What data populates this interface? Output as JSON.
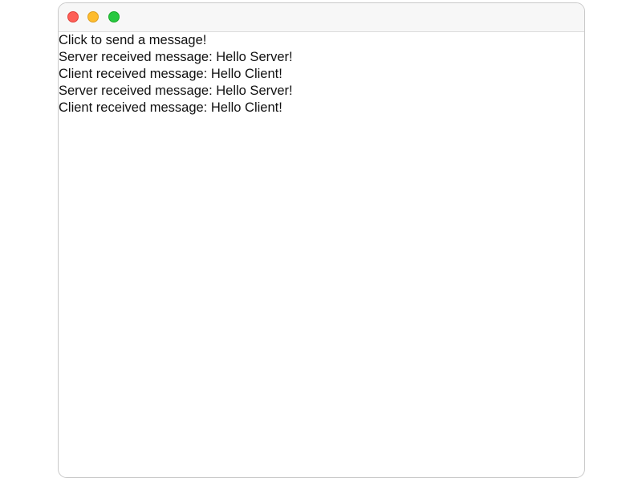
{
  "window": {
    "title": "",
    "buttons": {
      "close": "close",
      "minimize": "minimize",
      "zoom": "zoom"
    }
  },
  "content": {
    "prompt": "Click to send a message!",
    "messages": [
      "Server received message: Hello Server!",
      "Client received message: Hello Client!",
      "Server received message: Hello Server!",
      "Client received message: Hello Client!"
    ]
  },
  "colors": {
    "close": "#fe5f57",
    "minimize": "#febc2e",
    "zoom": "#28c840"
  }
}
